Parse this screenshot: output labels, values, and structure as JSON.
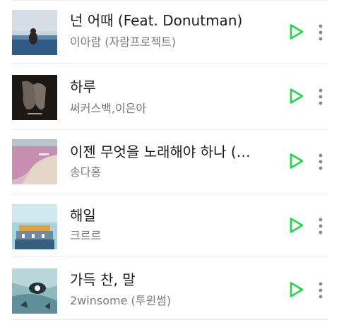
{
  "accent_color": "#1ed94a",
  "play_icon": "play-icon",
  "more_icon": "more-vertical-icon",
  "songs": [
    {
      "title": "넌 어때 (Feat. Donutman)",
      "artist": "이아람 (자람프로젝트)"
    },
    {
      "title": "하루",
      "artist": "써커스백,이은아"
    },
    {
      "title": "이젠 무엇을 노래해야 하나 (…",
      "artist": "송다홍"
    },
    {
      "title": "해일",
      "artist": "크르르"
    },
    {
      "title": "가득 찬, 말",
      "artist": "2winsome (투윈썸)"
    }
  ]
}
